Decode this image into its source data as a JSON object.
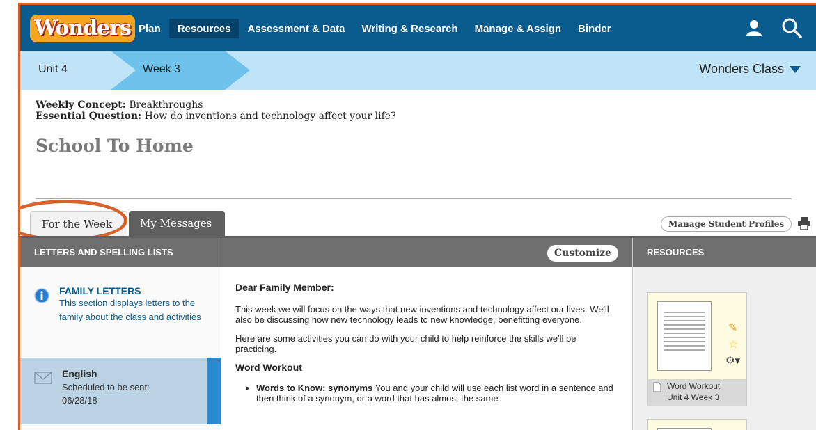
{
  "nav": {
    "logo": "Wonders",
    "items": [
      "Plan",
      "Resources",
      "Assessment & Data",
      "Writing & Research",
      "Manage & Assign",
      "Binder"
    ]
  },
  "breadcrumb": {
    "unit": "Unit 4",
    "week": "Week 3",
    "class_name": "Wonders Class"
  },
  "header": {
    "concept_label": "Weekly Concept:",
    "concept_value": "Breakthroughs",
    "question_label": "Essential Question:",
    "question_value": "How do inventions and technology affect your life?",
    "title": "School To Home"
  },
  "tabs": {
    "for_week": "For the Week",
    "my_messages": "My Messages",
    "manage_profiles": "Manage Student Profiles"
  },
  "left": {
    "head": "LETTERS AND SPELLING LISTS",
    "family_title": "FAMILY LETTERS",
    "family_desc": "This section displays letters to the family about the class and activities",
    "english_label": "English",
    "english_sched": "Scheduled to be sent:",
    "english_date": "06/28/18"
  },
  "middle": {
    "customize": "Customize",
    "greeting": "Dear Family Member:",
    "para1": "This week we will focus on the ways that new inventions and technology affect our lives. We'll also be discussing how new technology leads to new knowledge, benefitting everyone.",
    "para2": "Here are some activities you can do with your child to help reinforce the skills we'll be practicing.",
    "section": "Word Workout",
    "bullet_label": "Words to Know: synonyms",
    "bullet_text": "You and your child will use each list word in a sentence and then think of a synonym, or a word that has almost the same"
  },
  "right": {
    "head": "RESOURCES",
    "card_title": "Word Workout",
    "card_sub": "Unit 4 Week 3"
  }
}
